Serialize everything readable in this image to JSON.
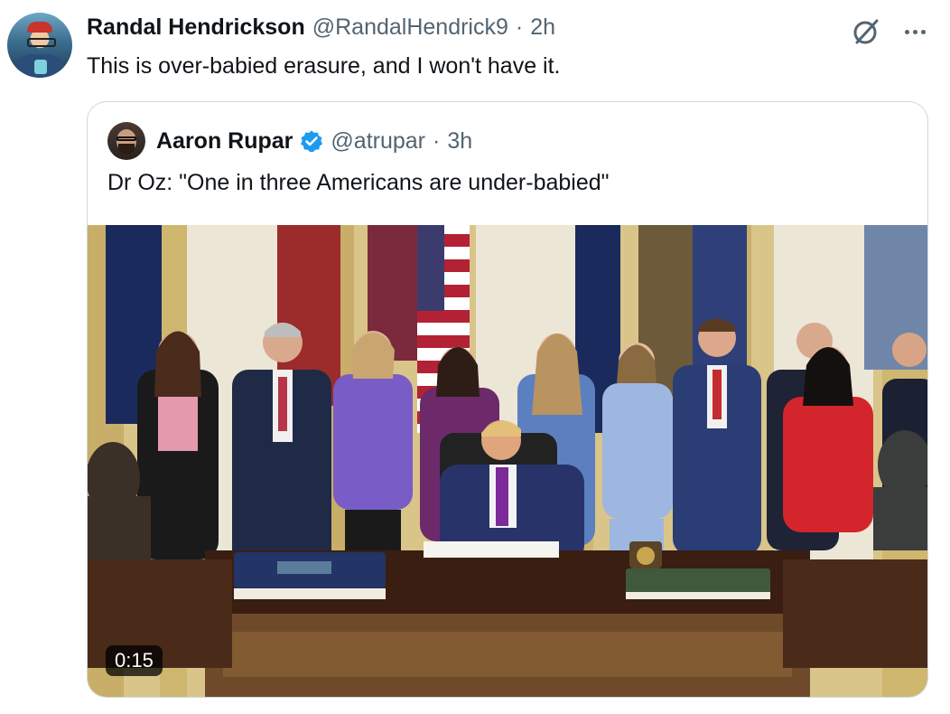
{
  "post": {
    "author_name": "Randal Hendrickson",
    "handle": "@RandalHendrick9",
    "separator": "·",
    "time": "2h",
    "text": "This is over-babied erasure, and I won't have it."
  },
  "icons": {
    "grok": "grok-slash-circle-icon",
    "more": "more-horizontal-icon",
    "verified": "verified-badge-icon"
  },
  "quote": {
    "author_name": "Aaron Rupar",
    "verified": true,
    "handle": "@atrupar",
    "separator": "·",
    "time": "3h",
    "text": "Dr Oz: \"One in three Americans are under-babied\"",
    "video": {
      "duration": "0:15"
    }
  },
  "colors": {
    "text_primary": "#0f1419",
    "text_secondary": "#536471",
    "verified_blue": "#1d9bf0",
    "border": "#cfd9de"
  }
}
